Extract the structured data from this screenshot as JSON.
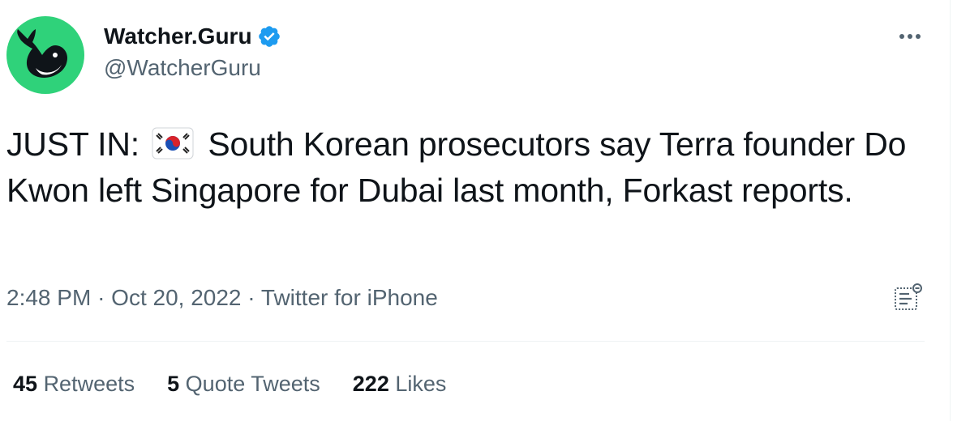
{
  "author": {
    "display_name": "Watcher.Guru",
    "handle": "@WatcherGuru",
    "avatar_color": "#2fd27a",
    "verified": true,
    "verified_color": "#1d9bf0"
  },
  "tweet": {
    "text_prefix": "JUST IN:",
    "flag_icon": "south-korea-flag-icon",
    "text_body": "South Korean prosecutors say Terra founder Do Kwon left Singapore for Dubai last month, Forkast reports."
  },
  "meta": {
    "time": "2:48 PM",
    "separator": "·",
    "date": "Oct 20, 2022",
    "source": "Twitter for iPhone"
  },
  "stats": {
    "retweets_count": "45",
    "retweets_label": "Retweets",
    "quotes_count": "5",
    "quotes_label": "Quote Tweets",
    "likes_count": "222",
    "likes_label": "Likes"
  },
  "icons": {
    "more": "more-dots-icon",
    "analytics": "analytics-icon"
  }
}
